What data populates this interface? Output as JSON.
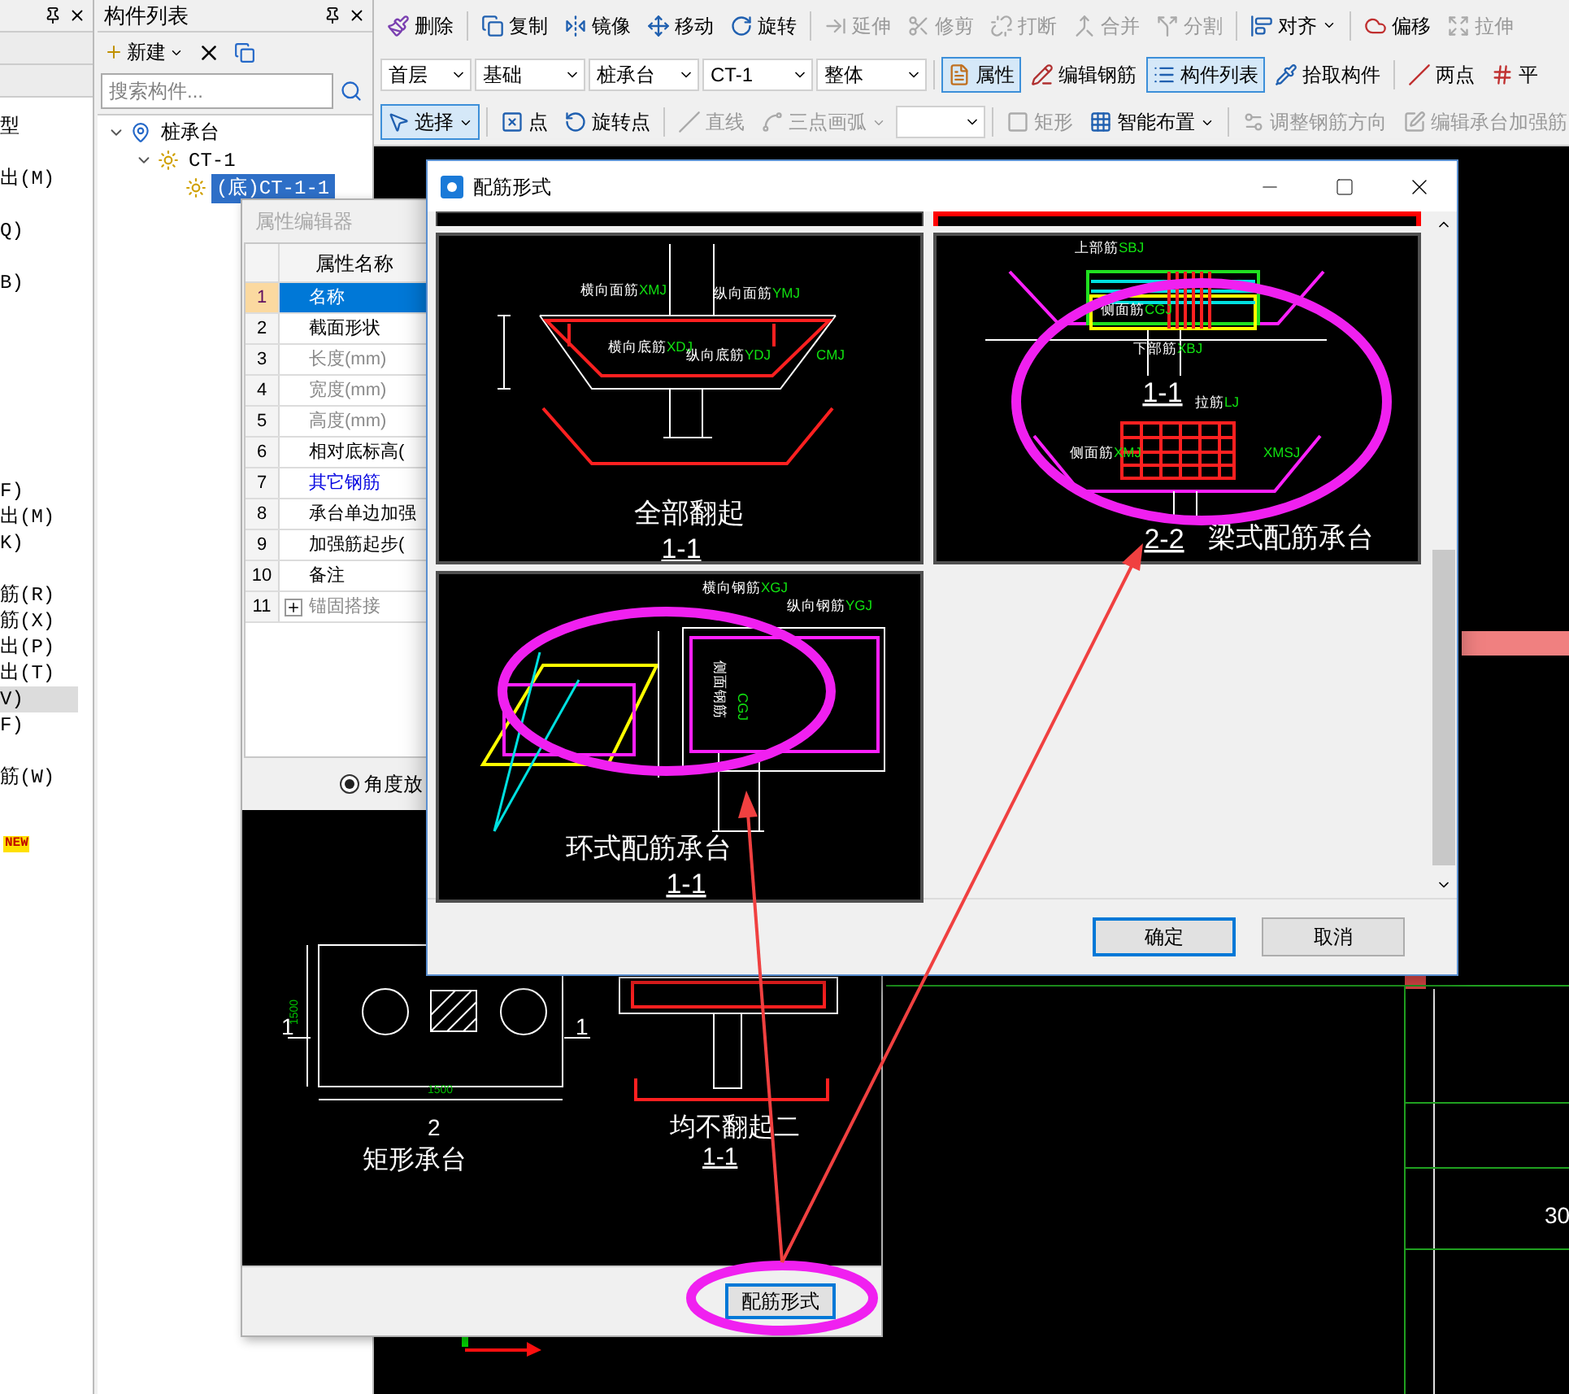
{
  "left_panel": {
    "items": [
      {
        "text": "型",
        "selected": false
      },
      {
        "text": "出(M)",
        "selected": false
      },
      {
        "text": "Q)",
        "selected": false
      },
      {
        "text": "B)",
        "selected": false
      },
      {
        "text": "F)",
        "selected": false
      },
      {
        "text": "出(M)",
        "selected": false
      },
      {
        "text": "K)",
        "selected": false
      },
      {
        "text": "筋(R)",
        "selected": false
      },
      {
        "text": "筋(X)",
        "selected": false
      },
      {
        "text": "出(P)",
        "selected": false
      },
      {
        "text": "出(T)",
        "selected": false
      },
      {
        "text": "V)",
        "selected": true
      },
      {
        "text": "F)",
        "selected": false
      },
      {
        "text": "筋(W)",
        "selected": false
      }
    ],
    "badge": "NEW"
  },
  "component_list": {
    "title": "构件列表",
    "new_button": "新建",
    "search": {
      "placeholder": "搜索构件..."
    },
    "tree": [
      {
        "label": "桩承台",
        "expanded": true,
        "selected": false,
        "children": [
          {
            "label": "CT-1",
            "expanded": true,
            "selected": false,
            "children": [
              {
                "label": "(底)CT-1-1",
                "selected": true
              }
            ]
          }
        ]
      }
    ]
  },
  "toolbar_rows": [
    [
      {
        "kind": "button",
        "label": "删除",
        "disabled": false
      },
      {
        "kind": "button",
        "label": "复制",
        "disabled": false
      },
      {
        "kind": "button",
        "label": "镜像",
        "disabled": false
      },
      {
        "kind": "button",
        "label": "移动",
        "disabled": false
      },
      {
        "kind": "button",
        "label": "旋转",
        "disabled": false
      },
      {
        "kind": "button",
        "label": "延伸",
        "disabled": true
      },
      {
        "kind": "button",
        "label": "修剪",
        "disabled": true
      },
      {
        "kind": "button",
        "label": "打断",
        "disabled": true
      },
      {
        "kind": "button",
        "label": "合并",
        "disabled": true
      },
      {
        "kind": "button",
        "label": "分割",
        "disabled": true
      },
      {
        "kind": "button",
        "label": "对齐",
        "disabled": false,
        "dropdown": true
      },
      {
        "kind": "button",
        "label": "偏移",
        "disabled": false
      },
      {
        "kind": "button",
        "label": "拉伸",
        "disabled": true
      }
    ],
    [
      {
        "kind": "select",
        "label": "首层"
      },
      {
        "kind": "select",
        "label": "基础"
      },
      {
        "kind": "select",
        "label": "桩承台"
      },
      {
        "kind": "select",
        "label": "CT-1"
      },
      {
        "kind": "select",
        "label": "整体"
      },
      {
        "kind": "button",
        "label": "属性",
        "disabled": false,
        "selected": true
      },
      {
        "kind": "button",
        "label": "编辑钢筋",
        "disabled": false,
        "selected": false
      },
      {
        "kind": "button",
        "label": "构件列表",
        "disabled": false,
        "selected": true
      },
      {
        "kind": "button",
        "label": "拾取构件",
        "disabled": false,
        "selected": false
      },
      {
        "kind": "button",
        "label": "两点",
        "disabled": false,
        "selected": false
      },
      {
        "kind": "button",
        "label": "平",
        "disabled": false,
        "selected": false
      }
    ],
    [
      {
        "kind": "button",
        "label": "选择",
        "disabled": false,
        "selected": true,
        "dropdown": true
      },
      {
        "kind": "button",
        "label": "点",
        "disabled": false,
        "selected": false
      },
      {
        "kind": "button",
        "label": "旋转点",
        "disabled": false,
        "selected": false
      },
      {
        "kind": "button",
        "label": "直线",
        "disabled": true,
        "selected": false
      },
      {
        "kind": "button",
        "label": "三点画弧",
        "disabled": true,
        "selected": false,
        "dropdown": true
      },
      {
        "kind": "select"
      },
      {
        "kind": "button",
        "label": "矩形",
        "disabled": true,
        "selected": false
      },
      {
        "kind": "button",
        "label": "智能布置",
        "disabled": false,
        "selected": false,
        "dropdown": true
      },
      {
        "kind": "button",
        "label": "调整钢筋方向",
        "disabled": true,
        "selected": false
      },
      {
        "kind": "button",
        "label": "编辑承台加强筋",
        "disabled": true,
        "selected": false
      }
    ]
  ],
  "canvas": {
    "axis_label": "30"
  },
  "property_editor": {
    "title": "属性编辑器",
    "header": "属性名称",
    "rows": [
      {
        "num": "1",
        "name": "名称",
        "kind": "normal",
        "selected": true
      },
      {
        "num": "2",
        "name": "截面形状",
        "kind": "normal",
        "selected": false
      },
      {
        "num": "3",
        "name": "长度(mm)",
        "kind": "disabled",
        "selected": false
      },
      {
        "num": "4",
        "name": "宽度(mm)",
        "kind": "disabled",
        "selected": false
      },
      {
        "num": "5",
        "name": "高度(mm)",
        "kind": "disabled",
        "selected": false
      },
      {
        "num": "6",
        "name": "相对底标高(",
        "kind": "normal",
        "selected": false
      },
      {
        "num": "7",
        "name": "其它钢筋",
        "kind": "link",
        "selected": false
      },
      {
        "num": "8",
        "name": "承台单边加强",
        "kind": "normal",
        "selected": false
      },
      {
        "num": "9",
        "name": "加强筋起步(",
        "kind": "normal",
        "selected": false
      },
      {
        "num": "10",
        "name": "备注",
        "kind": "normal",
        "selected": false
      },
      {
        "num": "11",
        "name": "锚固搭接",
        "kind": "group",
        "selected": false,
        "expanded": false
      }
    ],
    "options": [
      {
        "label": "角度放",
        "selected": true
      }
    ],
    "preview": {
      "rect_caption": "矩形承台",
      "rect_mark": "2",
      "side_marks": [
        "1",
        "1"
      ],
      "dims": [
        "1500",
        "1500"
      ],
      "flat_caption": "均不翻起二",
      "flat_section": "1-1"
    },
    "button": "配筋形式"
  },
  "dialog": {
    "title": "配筋形式",
    "scrolled_row": [
      {
        "selected": false
      },
      {
        "selected": true
      }
    ],
    "cells": [
      {
        "kind": "full-bend",
        "selected": false,
        "caption": "全部翻起",
        "sections": [
          "1-1"
        ],
        "labels": [
          {
            "text": "横向面筋",
            "code": "XMJ"
          },
          {
            "text": "纵向面筋",
            "code": "YMJ"
          },
          {
            "text": "横向底筋",
            "code": "XDJ"
          },
          {
            "text": "纵向底筋",
            "code": "YDJ"
          },
          {
            "code": "CMJ"
          }
        ]
      },
      {
        "kind": "beam",
        "selected": false,
        "caption": "梁式配筋承台",
        "sections": [
          "1-1",
          "2-2"
        ],
        "labels": [
          {
            "text": "上部筋",
            "code": "SBJ"
          },
          {
            "text": "侧面筋",
            "code": "CGJ"
          },
          {
            "text": "下部筋",
            "code": "XBJ"
          },
          {
            "text": "拉筋",
            "code": "LJ"
          },
          {
            "text": "侧面筋",
            "code": "XMJ"
          },
          {
            "code": "XMSJ"
          }
        ]
      },
      {
        "kind": "ring",
        "selected": false,
        "caption": "环式配筋承台",
        "sections": [
          "1-1"
        ],
        "labels": [
          {
            "text": "横向钢筋",
            "code": "XGJ"
          },
          {
            "text": "纵向钢筋",
            "code": "YGJ"
          },
          {
            "text": "侧面钢筋"
          },
          {
            "code": "CGJ"
          }
        ]
      }
    ],
    "buttons": [
      {
        "label": "确定",
        "focused": true
      },
      {
        "label": "取消",
        "focused": false
      }
    ]
  }
}
